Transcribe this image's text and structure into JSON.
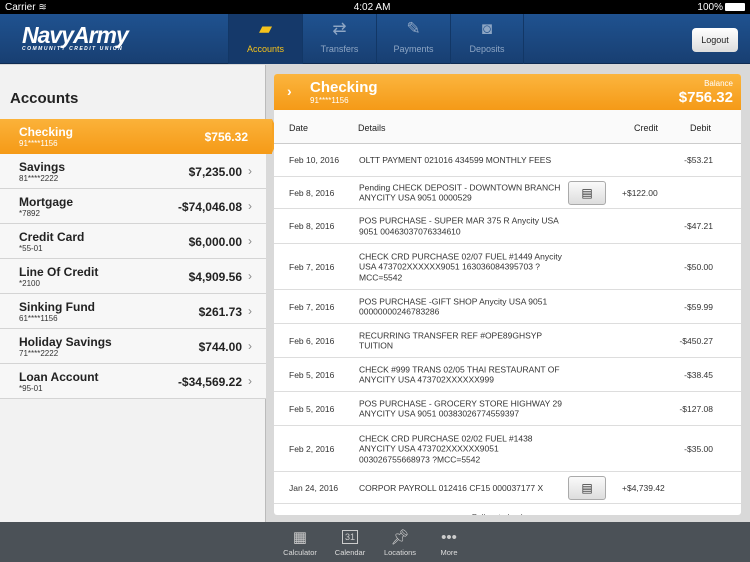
{
  "status": {
    "carrier": "Carrier",
    "time": "4:02 AM",
    "battery": "100%"
  },
  "brand": {
    "name": "NavyArmy",
    "tagline": "COMMUNITY CREDIT UNION"
  },
  "tabs": [
    {
      "label": "Accounts",
      "icon": "credit-card-icon"
    },
    {
      "label": "Transfers",
      "icon": "transfer-arrows-icon"
    },
    {
      "label": "Payments",
      "icon": "check-pen-icon"
    },
    {
      "label": "Deposits",
      "icon": "camera-icon"
    }
  ],
  "logout": "Logout",
  "accounts_title": "Accounts",
  "accounts": [
    {
      "name": "Checking",
      "number": "91****1156",
      "balance": "$756.32"
    },
    {
      "name": "Savings",
      "number": "81****2222",
      "balance": "$7,235.00"
    },
    {
      "name": "Mortgage",
      "number": "*7892",
      "balance": "-$74,046.08"
    },
    {
      "name": "Credit Card",
      "number": "*55-01",
      "balance": "$6,000.00"
    },
    {
      "name": "Line Of Credit",
      "number": "*2100",
      "balance": "$4,909.56"
    },
    {
      "name": "Sinking Fund",
      "number": "61****1156",
      "balance": "$261.73"
    },
    {
      "name": "Holiday Savings",
      "number": "71****2222",
      "balance": "$744.00"
    },
    {
      "name": "Loan Account",
      "number": "*95-01",
      "balance": "-$34,569.22"
    }
  ],
  "detail": {
    "title": "Checking",
    "number": "91****1156",
    "balance_label": "Balance",
    "balance": "$756.32",
    "columns": {
      "date": "Date",
      "details": "Details",
      "credit": "Credit",
      "debit": "Debit"
    },
    "transactions": [
      {
        "date": "Feb 10, 2016",
        "details": "OLTT PAYMENT 021016 434599 MONTHLY FEES",
        "credit": "",
        "debit": "-$53.21"
      },
      {
        "date": "Feb 8, 2016",
        "details": "Pending CHECK DEPOSIT - DOWNTOWN BRANCH ANYCITY USA 9051 0000529",
        "credit": "+$122.00",
        "debit": "",
        "image": true
      },
      {
        "date": "Feb 8, 2016",
        "details": "POS PURCHASE -  SUPER MAR 375 R Anycity USA 9051 00463037076334610",
        "credit": "",
        "debit": "-$47.21"
      },
      {
        "date": "Feb 7, 2016",
        "details": "CHECK CRD PURCHASE 02/07  FUEL #1449 Anycity USA 473702XXXXXX9051 163036084395703 ?MCC=5542",
        "credit": "",
        "debit": "-$50.00"
      },
      {
        "date": "Feb 7, 2016",
        "details": "POS PURCHASE -GIFT SHOP Anycity USA 9051 00000000246783286",
        "credit": "",
        "debit": "-$59.99"
      },
      {
        "date": "Feb 6, 2016",
        "details": "RECURRING TRANSFER REF #OPE89GHSYP TUITION",
        "credit": "",
        "debit": "-$450.27"
      },
      {
        "date": "Feb 5, 2016",
        "details": "CHECK #999 TRANS 02/05 THAI RESTAURANT OF ANYCITY USA 473702XXXXXX999",
        "credit": "",
        "debit": "-$38.45"
      },
      {
        "date": "Feb 5, 2016",
        "details": "POS PURCHASE - GROCERY STORE HIGHWAY 29 ANYCITY USA 9051 00383026774559397",
        "credit": "",
        "debit": "-$127.08"
      },
      {
        "date": "Feb 2, 2016",
        "details": "CHECK CRD PURCHASE 02/02 FUEL #1438 ANYCITY USA 473702XXXXXX9051 003026755668973 ?MCC=5542",
        "credit": "",
        "debit": "-$35.00"
      },
      {
        "date": "Jan 24, 2016",
        "details": "CORPOR PAYROLL 012416 CF15 000037177 X",
        "credit": "+$4,739.42",
        "debit": "",
        "image": true
      }
    ],
    "load_more": "Pull up to load more"
  },
  "bottom": [
    {
      "label": "Calculator",
      "icon": "calculator-icon"
    },
    {
      "label": "Calendar",
      "icon": "calendar-icon",
      "day": "31"
    },
    {
      "label": "Locations",
      "icon": "pushpin-icon"
    },
    {
      "label": "More",
      "icon": "more-dots-icon"
    }
  ]
}
